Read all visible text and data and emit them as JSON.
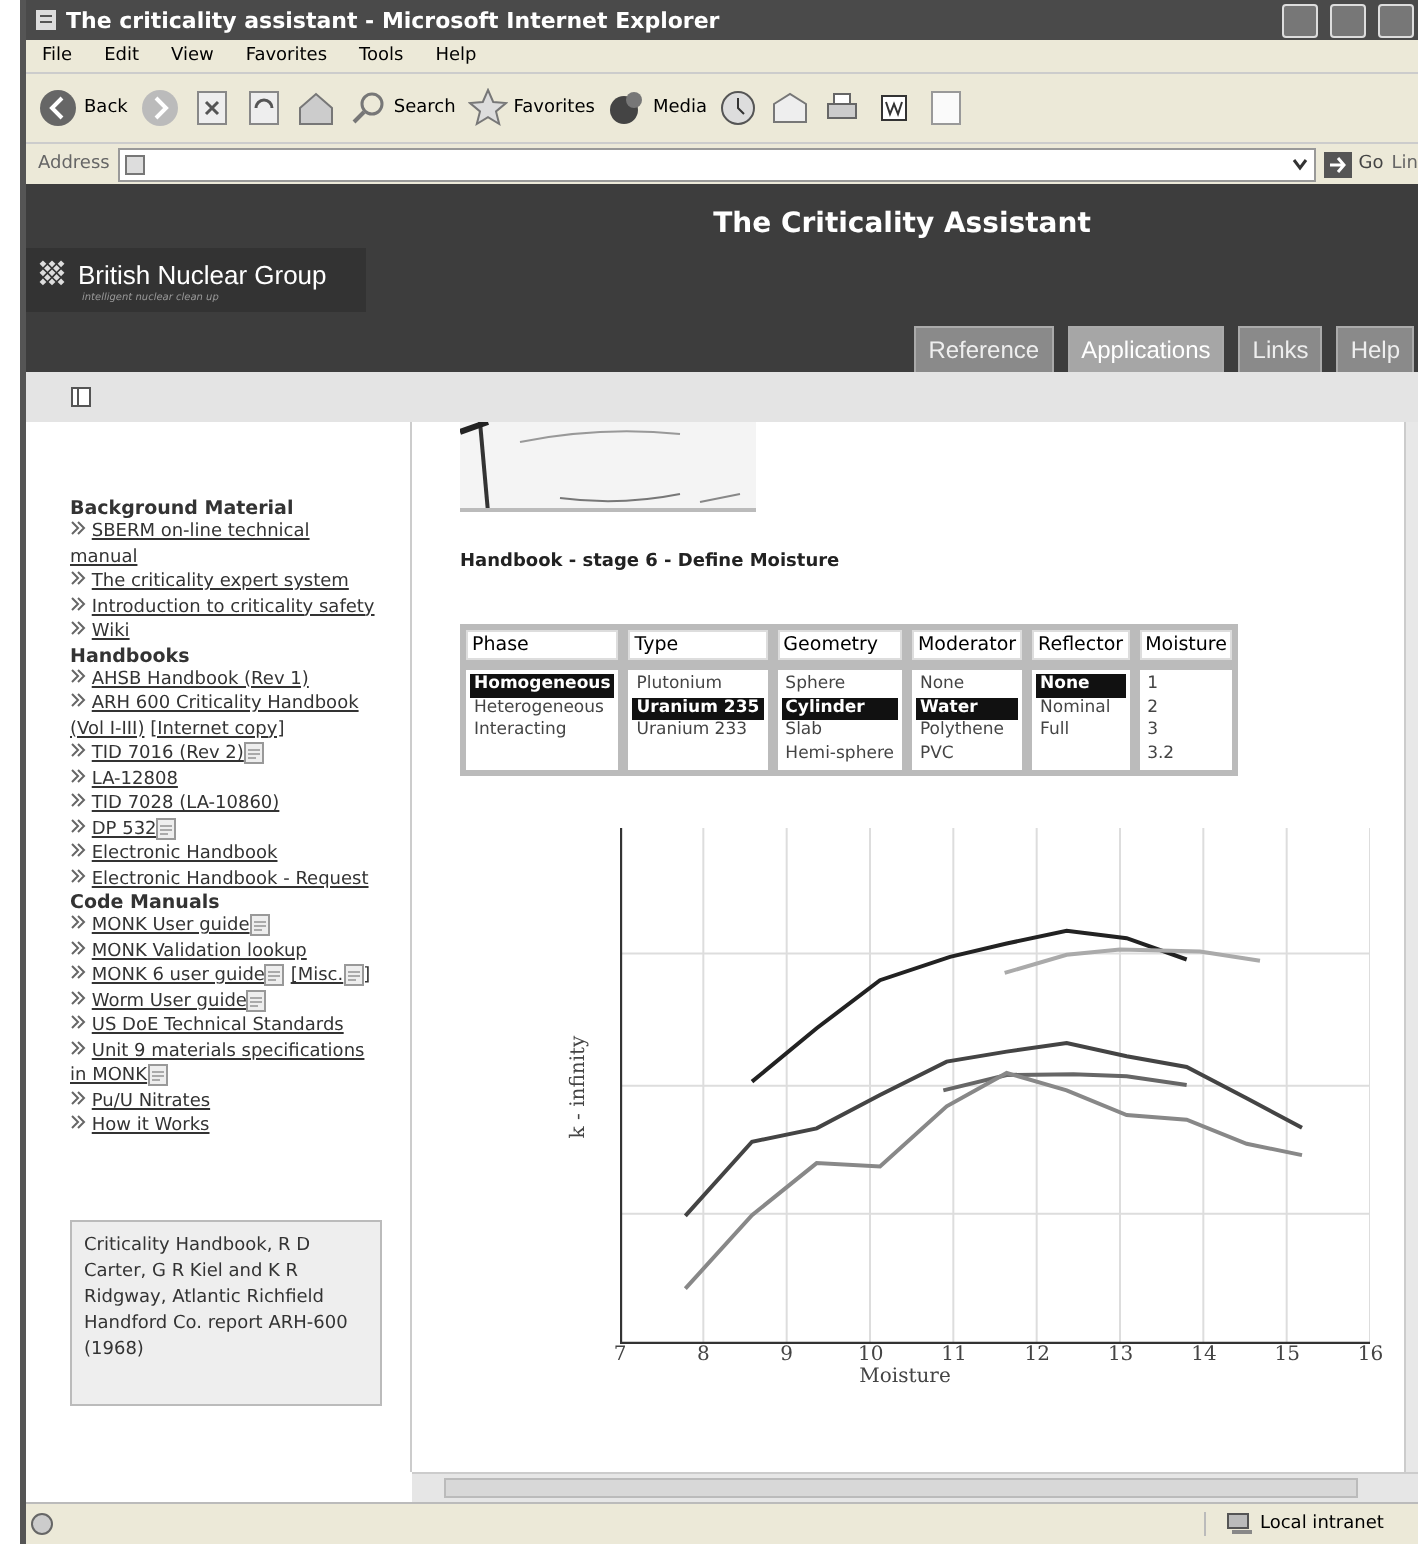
{
  "window": {
    "title": "The criticality assistant - Microsoft Internet Explorer"
  },
  "menu": [
    "File",
    "Edit",
    "View",
    "Favorites",
    "Tools",
    "Help"
  ],
  "toolbar": {
    "back": "Back",
    "search": "Search",
    "favorites": "Favorites",
    "media": "Media"
  },
  "address": {
    "label": "Address",
    "go": "Go",
    "links": "Lin"
  },
  "site": {
    "title": "The Criticality Assistant",
    "logo": "British Nuclear Group",
    "tagline": "intelligent nuclear clean up"
  },
  "tabs": [
    {
      "label": "Reference",
      "selected": false
    },
    {
      "label": "Applications",
      "selected": true
    },
    {
      "label": "Links",
      "selected": false
    },
    {
      "label": "Help",
      "selected": false
    }
  ],
  "sidebar": {
    "sections": [
      {
        "heading": "Background Material",
        "links": [
          {
            "text": "SBERM on-line technical manual"
          },
          {
            "text": "The criticality expert system"
          },
          {
            "text": "Introduction to criticality safety"
          },
          {
            "text": "Wiki"
          }
        ]
      },
      {
        "heading": "Handbooks",
        "links": [
          {
            "text": "AHSB Handbook (Rev 1)"
          },
          {
            "text": "ARH 600 Criticality Handbook (Vol I-III)",
            "extra": {
              "text": "[Internet copy]"
            }
          },
          {
            "text": "TID 7016 (Rev 2)",
            "doc": true
          },
          {
            "text": "LA-12808"
          },
          {
            "text": "TID 7028 (LA-10860)"
          },
          {
            "text": "DP 532",
            "doc": true
          },
          {
            "text": "Electronic Handbook"
          },
          {
            "text": "Electronic Handbook - Request"
          }
        ]
      },
      {
        "heading": "Code Manuals",
        "links": [
          {
            "text": "MONK User guide",
            "doc": true
          },
          {
            "text": "MONK Validation lookup"
          },
          {
            "text": "MONK 6 user guide",
            "doc": true,
            "extra": {
              "text": "[Misc.",
              "doc": true,
              "after": "]"
            }
          },
          {
            "text": "Worm User guide",
            "doc": true
          },
          {
            "text": "US DoE Technical Standards"
          },
          {
            "text": "Unit 9 materials specifications in MONK",
            "doc": true
          },
          {
            "text": "Pu/U Nitrates"
          },
          {
            "text": "How it Works"
          }
        ]
      }
    ],
    "note": "Criticality Handbook, R D Carter, G R Kiel and K R Ridgway, Atlantic Richfield Handford Co. report ARH-600 (1968)"
  },
  "content": {
    "heading": "Handbook - stage 6 - Define Moisture",
    "selector": [
      {
        "header": "Phase",
        "options": [
          {
            "label": "Homogeneous",
            "selected": true
          },
          {
            "label": "Heterogeneous",
            "selected": false
          },
          {
            "label": "Interacting",
            "selected": false
          }
        ]
      },
      {
        "header": "Type",
        "options": [
          {
            "label": "Plutonium",
            "selected": false
          },
          {
            "label": "Uranium 235",
            "selected": true
          },
          {
            "label": "Uranium 233",
            "selected": false
          }
        ]
      },
      {
        "header": "Geometry",
        "options": [
          {
            "label": "Sphere",
            "selected": false
          },
          {
            "label": "Cylinder",
            "selected": true
          },
          {
            "label": "Slab",
            "selected": false
          },
          {
            "label": "Hemi-sphere",
            "selected": false
          }
        ]
      },
      {
        "header": "Moderator",
        "options": [
          {
            "label": "None",
            "selected": false
          },
          {
            "label": "Water",
            "selected": true
          },
          {
            "label": "Polythene",
            "selected": false
          },
          {
            "label": "PVC",
            "selected": false
          }
        ]
      },
      {
        "header": "Reflector",
        "options": [
          {
            "label": "None",
            "selected": true
          },
          {
            "label": "Nominal",
            "selected": false
          },
          {
            "label": "Full",
            "selected": false
          }
        ]
      },
      {
        "header": "Moisture",
        "options": [
          {
            "label": "1",
            "selected": false
          },
          {
            "label": "2",
            "selected": false
          },
          {
            "label": "3",
            "selected": false
          },
          {
            "label": "3.2",
            "selected": false
          }
        ]
      }
    ],
    "chart": {
      "xlabel": "Moisture",
      "ylabel": "k - infinity",
      "xticks": [
        "7",
        "8",
        "9",
        "10",
        "11",
        "12",
        "13",
        "14",
        "15",
        "16"
      ]
    }
  },
  "status_bar": {
    "zone": "Local intranet"
  }
}
